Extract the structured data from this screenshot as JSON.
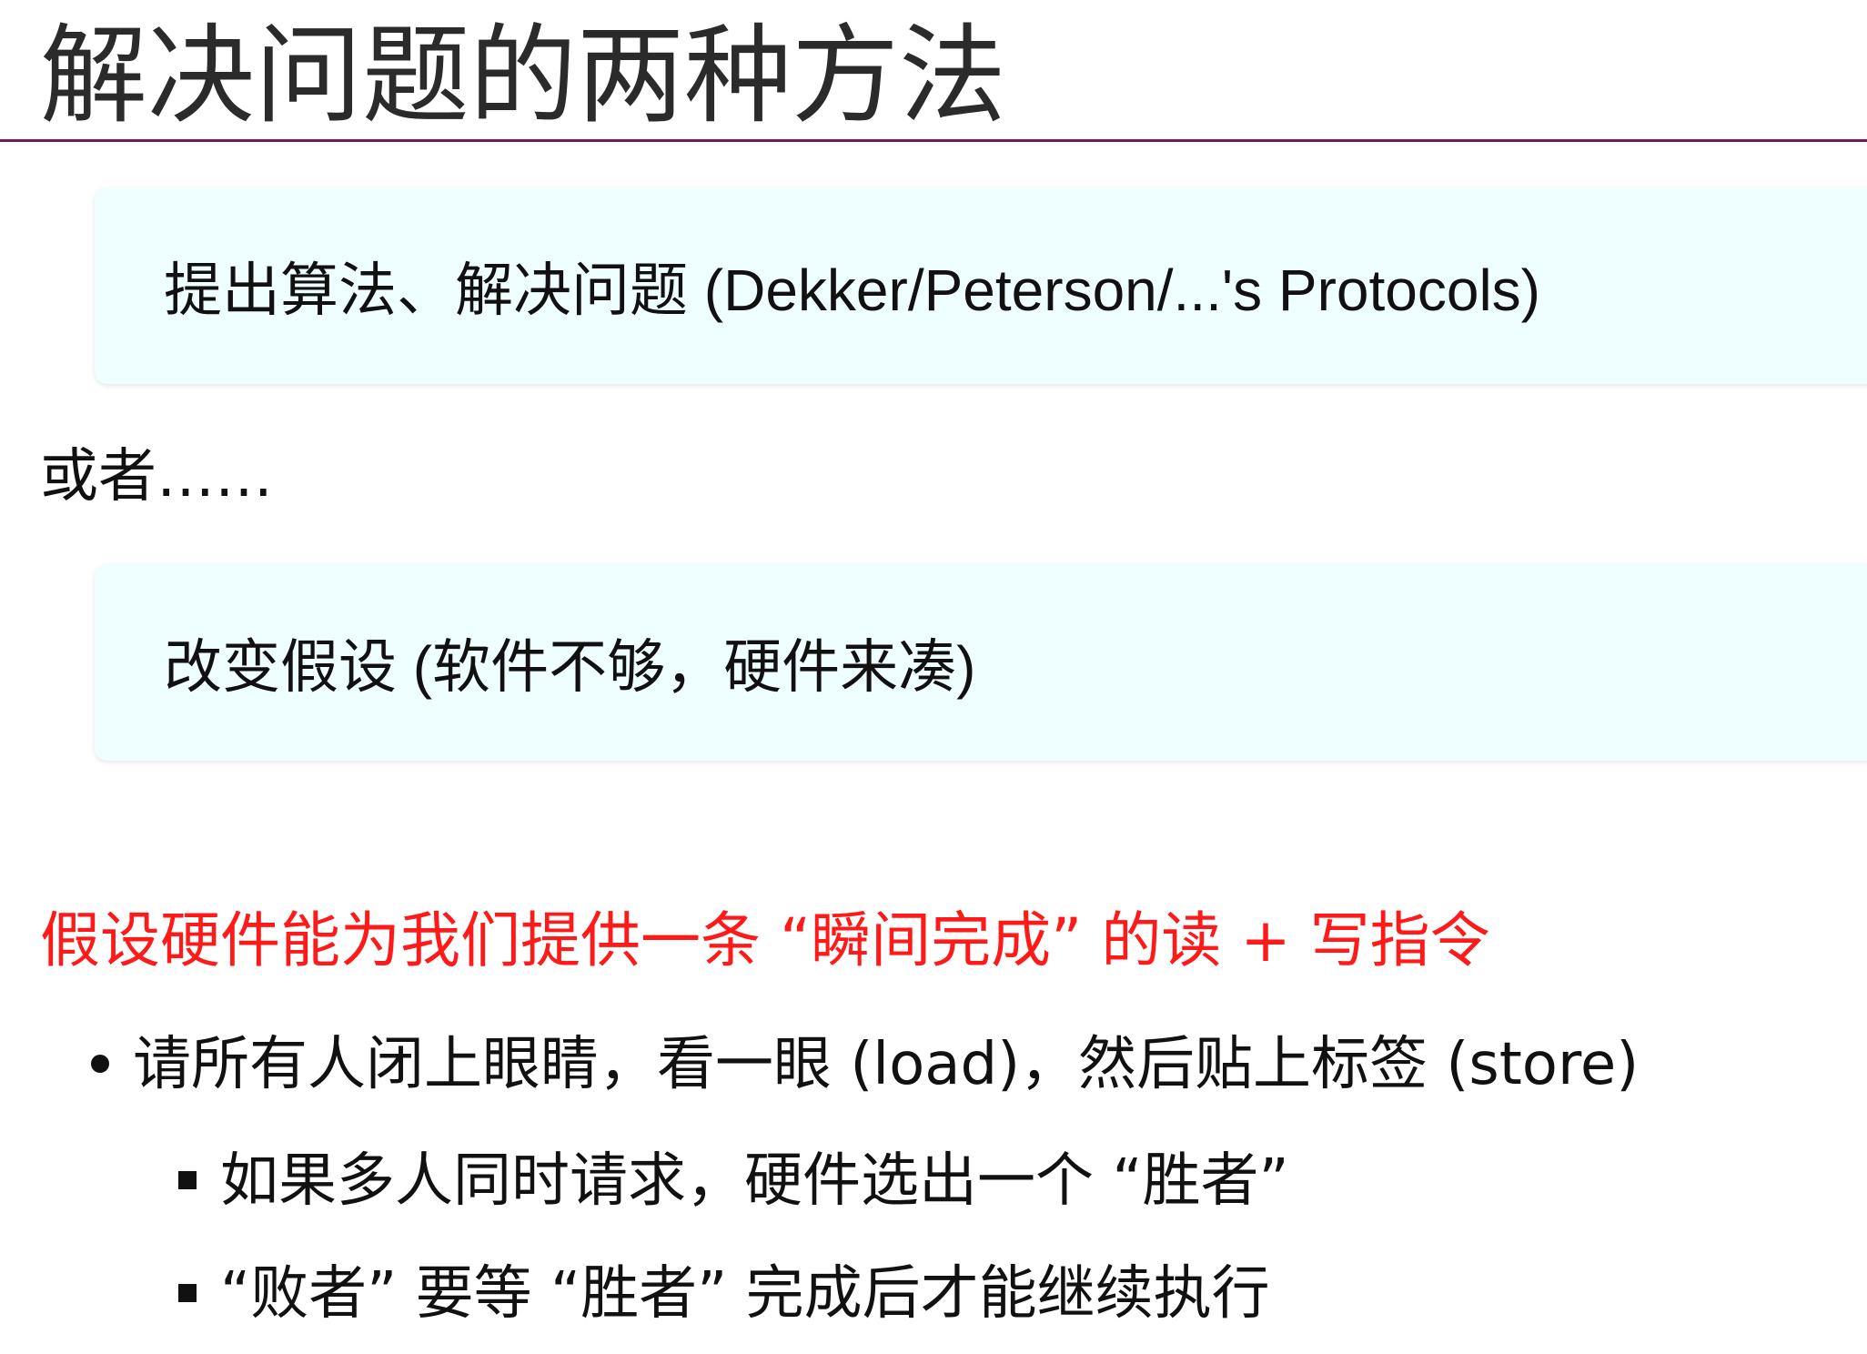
{
  "slide": {
    "title": "解决问题的两种方法",
    "callout_1": {
      "cn_text": "提出算法、解决问题",
      "latin_text": " (Dekker/Peterson/...'s Protocols)"
    },
    "connector": "或者……",
    "callout_2": {
      "text_part1": "改变假设",
      "paren_open": " (",
      "text_part2": "软件不够，硬件来凑",
      "paren_close": ")"
    },
    "highlight": "假设硬件能为我们提供一条 “瞬间完成” 的读 + 写指令",
    "bullets": {
      "level1": "请所有人闭上眼睛，看一眼 (load)，然后贴上标签 (store)",
      "level2": [
        "如果多人同时请求，硬件选出一个 “胜者”",
        "“败者” 要等 “胜者” 完成后才能继续执行"
      ]
    }
  },
  "colors": {
    "title_rule": "#6e1e5e",
    "callout_bg": "#effefe",
    "highlight_text": "#ff1a1a"
  }
}
